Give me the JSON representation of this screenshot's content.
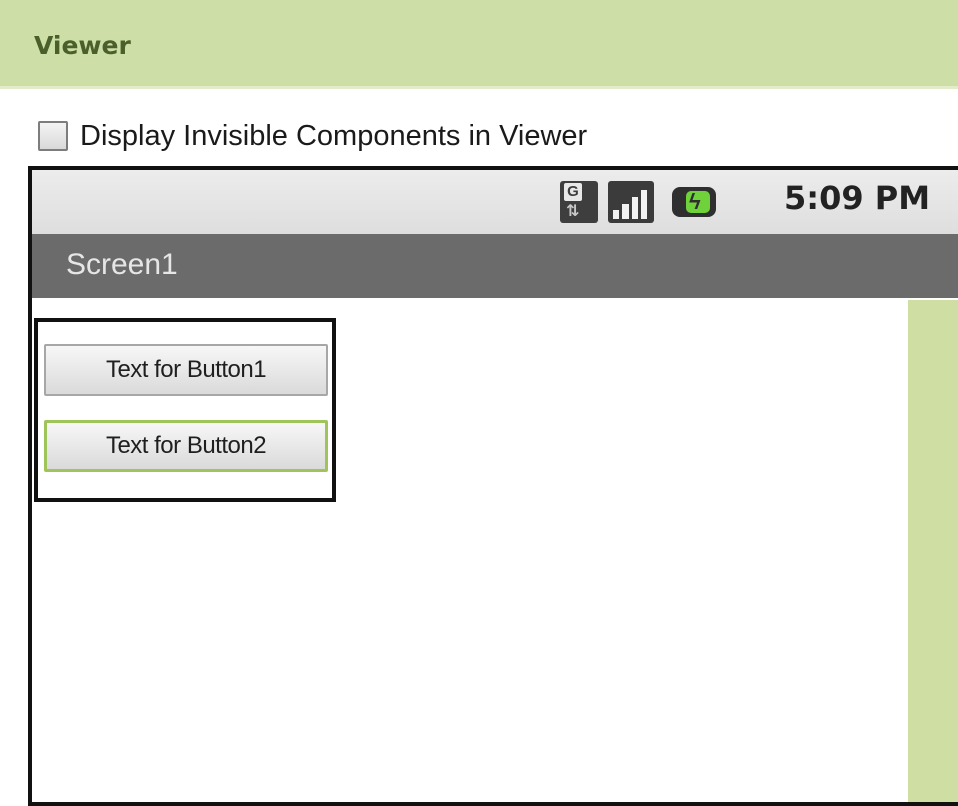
{
  "header": {
    "title": "Viewer"
  },
  "options": {
    "invisible_components_label": "Display Invisible Components in Viewer",
    "invisible_components_checked": false
  },
  "phone": {
    "status_bar": {
      "time": "5:09 PM",
      "icons": [
        "network-g-icon",
        "signal-icon",
        "battery-charging-icon"
      ],
      "network_letter": "G"
    },
    "screen_title": "Screen1",
    "arrangement": {
      "buttons": [
        {
          "label": "Text for Button1",
          "selected": false
        },
        {
          "label": "Text for Button2",
          "selected": true
        }
      ]
    }
  },
  "colors": {
    "header_bg": "#cddfa6",
    "header_text": "#4b5f2c",
    "title_bar_bg": "#6b6b6b",
    "selected_outline": "#9fc45a",
    "battery_green": "#6fd23a"
  }
}
